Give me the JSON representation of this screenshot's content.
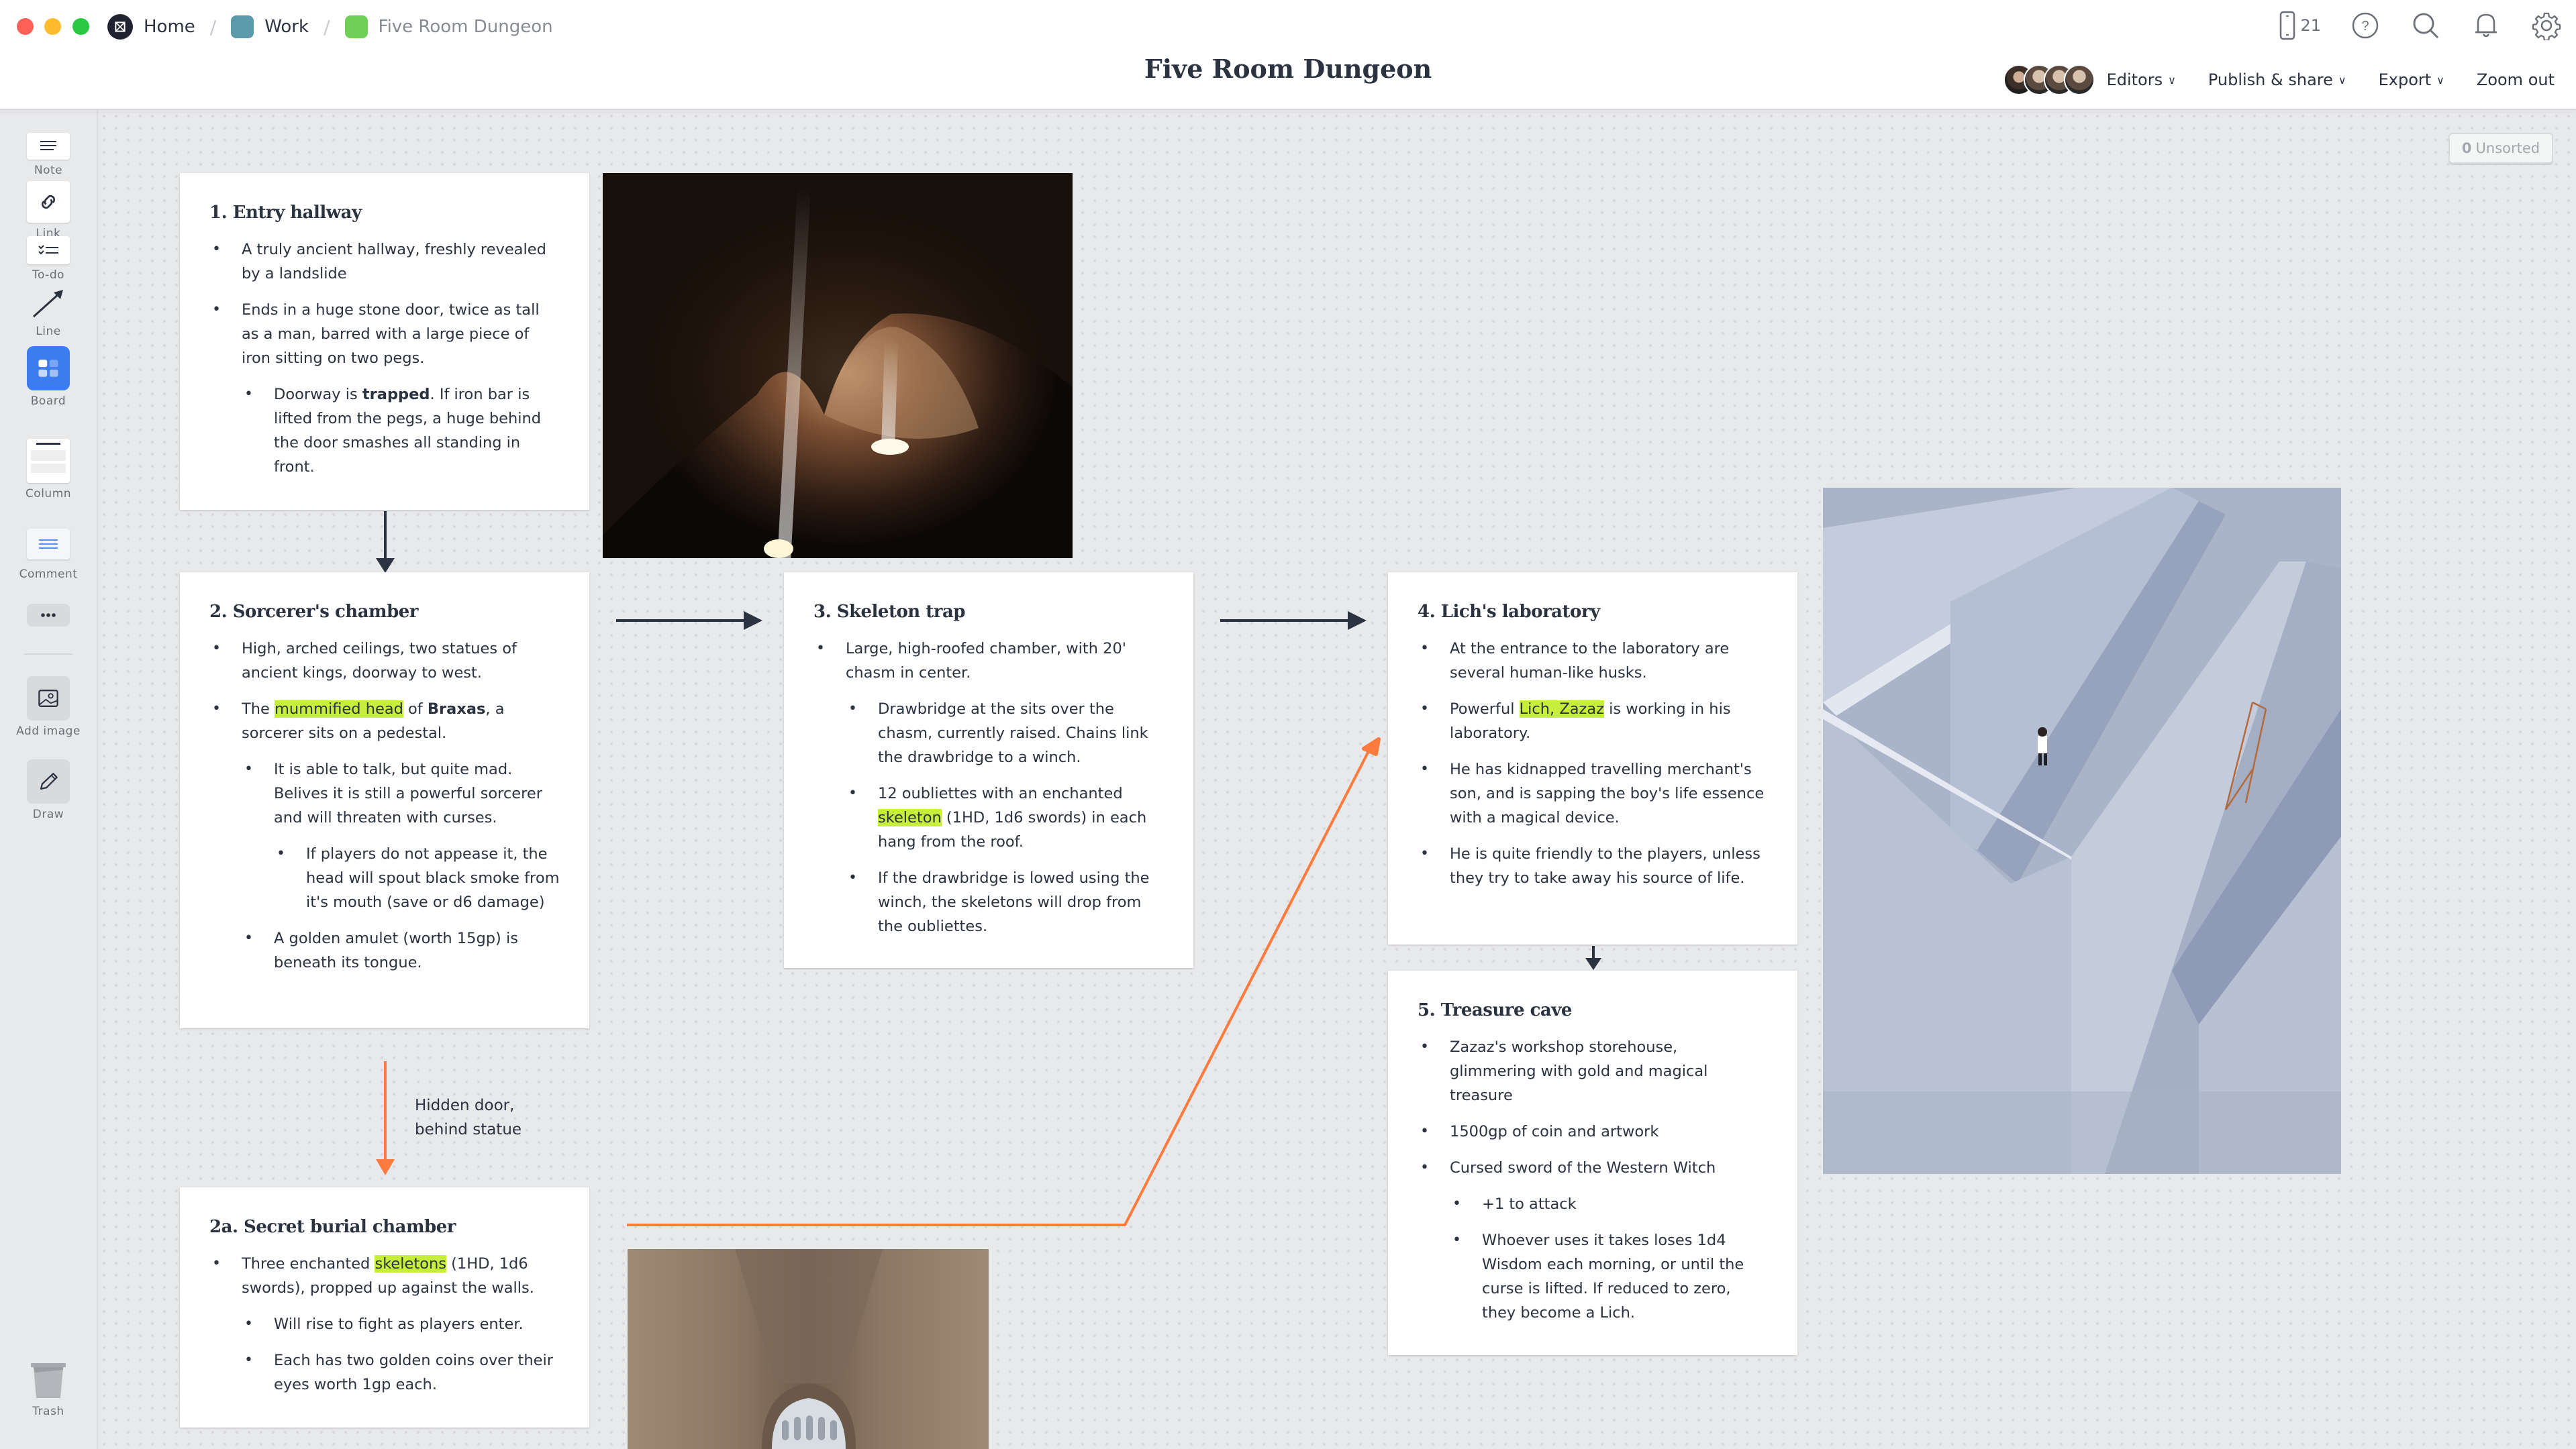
{
  "window": {
    "breadcrumbs": [
      {
        "label": "Home",
        "icon": "milanote-logo-icon"
      },
      {
        "label": "Work",
        "icon": "board-icon",
        "color": "#5b9aab"
      },
      {
        "label": "Five Room Dungeon",
        "icon": "board-icon",
        "color": "#6fcf57"
      }
    ],
    "title": "Five Room Dungeon",
    "device_count": "21"
  },
  "toolbar": {
    "editors_label": "Editors",
    "publish_label": "Publish & share",
    "export_label": "Export",
    "zoom_label": "Zoom out"
  },
  "sidebar": {
    "tools": [
      {
        "label": "Note",
        "icon": "note-icon"
      },
      {
        "label": "Link",
        "icon": "link-icon"
      },
      {
        "label": "To-do",
        "icon": "todo-icon"
      },
      {
        "label": "Line",
        "icon": "line-arrow-icon"
      },
      {
        "label": "Board",
        "icon": "board-icon"
      },
      {
        "label": "Column",
        "icon": "column-icon"
      },
      {
        "label": "Comment",
        "icon": "comment-icon"
      },
      {
        "label": "",
        "icon": "more-icon"
      },
      {
        "label": "Add image",
        "icon": "image-icon"
      },
      {
        "label": "Draw",
        "icon": "pencil-icon"
      }
    ],
    "trash_label": "Trash"
  },
  "unsorted": {
    "count": "0",
    "label": "Unsorted"
  },
  "colors": {
    "accent_blue": "#3b7cf0",
    "highlight": "#c5ef3c",
    "connector_dark": "#2b3240",
    "connector_orange": "#ff7a3d"
  },
  "cards": {
    "entry": {
      "title": "1. Entry hallway",
      "items": [
        {
          "level": 1,
          "segments": [
            {
              "text": "A truly ancient hallway, freshly revealed by a landslide"
            }
          ]
        },
        {
          "level": 1,
          "segments": [
            {
              "text": "Ends in a huge stone door, twice as tall as a man, barred with a large piece of iron sitting on two pegs."
            }
          ]
        },
        {
          "level": 2,
          "segments": [
            {
              "text": "Doorway is "
            },
            {
              "text": "trapped",
              "bold": true
            },
            {
              "text": ". If iron bar is lifted from the pegs, a huge behind the door smashes all standing in front."
            }
          ]
        }
      ]
    },
    "sorcerer": {
      "title": "2. Sorcerer's chamber",
      "items": [
        {
          "level": 1,
          "segments": [
            {
              "text": "High, arched ceilings, two statues of ancient kings, doorway to west."
            }
          ]
        },
        {
          "level": 1,
          "segments": [
            {
              "text": "The "
            },
            {
              "text": "mummified head",
              "highlight": true
            },
            {
              "text": " of "
            },
            {
              "text": "Braxas",
              "bold": true
            },
            {
              "text": ", a sorcerer sits on a pedestal."
            }
          ]
        },
        {
          "level": 2,
          "segments": [
            {
              "text": "It is able to talk, but quite mad. Belives it is still a powerful sorcerer and will threaten with curses."
            }
          ]
        },
        {
          "level": 3,
          "segments": [
            {
              "text": "If players do not appease it, the head will spout black smoke from it's mouth (save or d6 damage)"
            }
          ]
        },
        {
          "level": 2,
          "segments": [
            {
              "text": "A golden amulet (worth 15gp) is beneath its tongue."
            }
          ]
        }
      ]
    },
    "skeleton": {
      "title": "3. Skeleton trap",
      "items": [
        {
          "level": 1,
          "segments": [
            {
              "text": "Large, high-roofed chamber, with 20' chasm in center."
            }
          ]
        },
        {
          "level": 2,
          "segments": [
            {
              "text": "Drawbridge at the sits over the chasm, currently raised. Chains link the drawbridge to a winch."
            }
          ]
        },
        {
          "level": 2,
          "segments": [
            {
              "text": "12 oubliettes with an enchanted "
            },
            {
              "text": "skeleton",
              "highlight": true
            },
            {
              "text": " (1HD, 1d6 swords) in each hang from the roof."
            }
          ]
        },
        {
          "level": 2,
          "segments": [
            {
              "text": "If the drawbridge is lowed using the winch, the skeletons will drop from the oubliettes."
            }
          ]
        }
      ]
    },
    "lich": {
      "title": "4. Lich's laboratory",
      "items": [
        {
          "level": 1,
          "segments": [
            {
              "text": "At the entrance to the laboratory are several human-like husks."
            }
          ]
        },
        {
          "level": 1,
          "segments": [
            {
              "text": "Powerful "
            },
            {
              "text": "Lich, Zazaz",
              "highlight": true
            },
            {
              "text": " is working in his laboratory."
            }
          ]
        },
        {
          "level": 1,
          "segments": [
            {
              "text": "He has kidnapped travelling merchant's son, and is sapping the boy's life essence with a magical device."
            }
          ]
        },
        {
          "level": 1,
          "segments": [
            {
              "text": "He is quite friendly to the players, unless they try to take away his source of life."
            }
          ]
        }
      ]
    },
    "treasure": {
      "title": "5. Treasure cave",
      "items": [
        {
          "level": 1,
          "segments": [
            {
              "text": "Zazaz's workshop storehouse, glimmering with gold and magical treasure"
            }
          ]
        },
        {
          "level": 1,
          "segments": [
            {
              "text": "1500gp of coin and artwork"
            }
          ]
        },
        {
          "level": 1,
          "segments": [
            {
              "text": "Cursed sword of the Western Witch"
            }
          ]
        },
        {
          "level": 2,
          "segments": [
            {
              "text": "+1 to attack"
            }
          ]
        },
        {
          "level": 2,
          "segments": [
            {
              "text": "Whoever uses it takes loses 1d4 Wisdom each morning, or until the curse is lifted. If reduced to zero, they become a Lich."
            }
          ]
        }
      ]
    },
    "burial": {
      "title": "2a. Secret burial chamber",
      "items": [
        {
          "level": 1,
          "segments": [
            {
              "text": "Three enchanted "
            },
            {
              "text": "skeletons",
              "highlight": true
            },
            {
              "text": " (1HD, 1d6 swords), propped up against the walls."
            }
          ]
        },
        {
          "level": 2,
          "segments": [
            {
              "text": "Will rise to fight as players enter."
            }
          ]
        },
        {
          "level": 2,
          "segments": [
            {
              "text": "Each has two golden coins over their eyes worth 1gp each."
            }
          ]
        }
      ]
    }
  },
  "edge_label": {
    "line1": "Hidden door,",
    "line2": "behind statue"
  },
  "images": [
    {
      "name": "cave-photo",
      "description": "Dark cave with light beams"
    },
    {
      "name": "maze-photo",
      "description": "Aerial view of concrete maze with person"
    },
    {
      "name": "corridor-photo",
      "description": "Brick vaulted corridor with arch"
    }
  ]
}
